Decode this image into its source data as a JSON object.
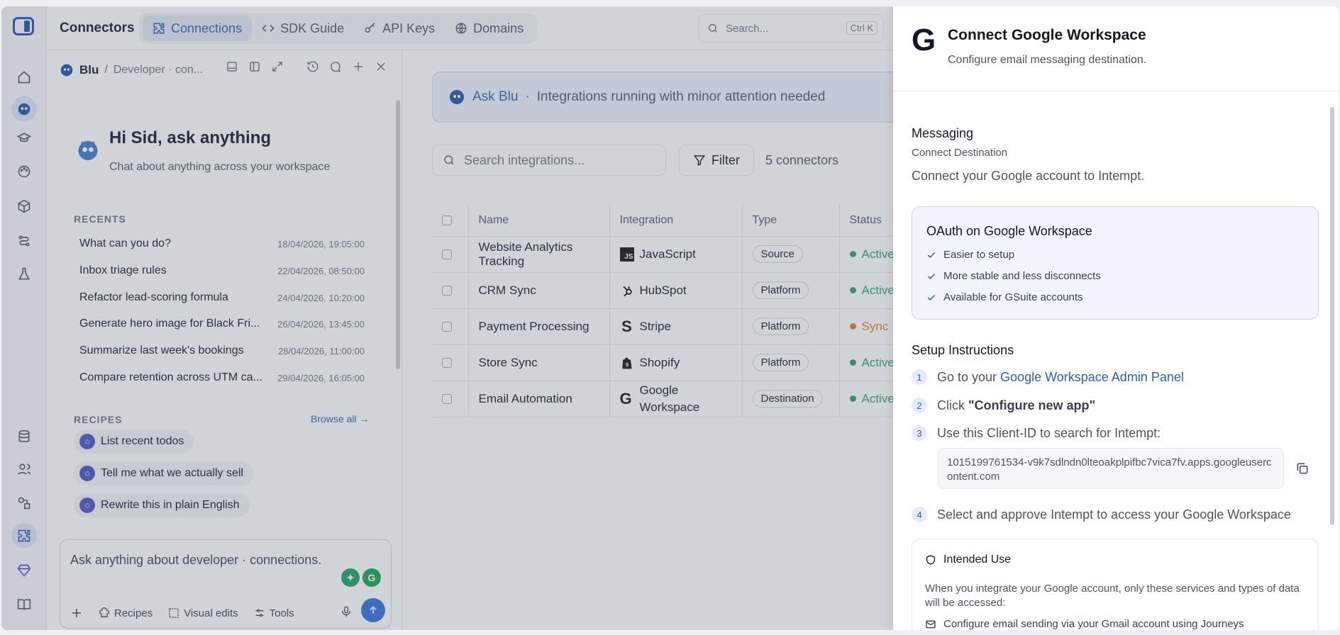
{
  "app": {
    "title": "Connectors"
  },
  "tabs": [
    {
      "label": "Connections"
    },
    {
      "label": "SDK Guide"
    },
    {
      "label": "API Keys"
    },
    {
      "label": "Domains"
    }
  ],
  "search": {
    "placeholder": "Search...",
    "shortcut": "Ctrl K"
  },
  "chat": {
    "agent_name": "Blu",
    "crumb": "Developer · con...",
    "greeting": "Hi Sid, ask anything",
    "subtitle": "Chat about anything across your workspace",
    "recents_label": "RECENTS",
    "recents": [
      {
        "title": "What can you do?",
        "date": "18/04/2026, 19:05:00"
      },
      {
        "title": "Inbox triage rules",
        "date": "22/04/2026, 08:50:00"
      },
      {
        "title": "Refactor lead-scoring formula",
        "date": "24/04/2026, 10:20:00"
      },
      {
        "title": "Generate hero image for Black Fri...",
        "date": "26/04/2026, 13:45:00"
      },
      {
        "title": "Summarize last week's bookings",
        "date": "28/04/2026, 11:00:00"
      },
      {
        "title": "Compare retention across UTM ca...",
        "date": "29/04/2026, 16:05:00"
      }
    ],
    "recipes_label": "RECIPES",
    "browse_all": "Browse all →",
    "recipes": [
      "List recent todos",
      "Tell me what we actually sell",
      "Rewrite this in plain English"
    ],
    "input_placeholder": "Ask anything about developer · connections.",
    "tools": {
      "recipes": "Recipes",
      "visual_edits": "Visual edits",
      "tools": "Tools"
    }
  },
  "main": {
    "ask_label": "Ask Blu",
    "ask_status": "Integrations running with minor attention needed",
    "search_placeholder": "Search integrations...",
    "filter_label": "Filter",
    "count": "5 connectors",
    "columns": [
      "Name",
      "Integration",
      "Type",
      "Status"
    ],
    "rows": [
      {
        "name": "Website Analytics Tracking",
        "integration": "JavaScript",
        "type": "Source",
        "status": "Active",
        "status_color": "#2f9e5a",
        "icon": "js-icon"
      },
      {
        "name": "CRM Sync",
        "integration": "HubSpot",
        "type": "Platform",
        "status": "Active",
        "status_color": "#2f9e5a",
        "icon": "hubspot-icon"
      },
      {
        "name": "Payment Processing",
        "integration": "Stripe",
        "type": "Platform",
        "status": "Sync",
        "status_color": "#d9822b",
        "icon": "stripe-icon"
      },
      {
        "name": "Store Sync",
        "integration": "Shopify",
        "type": "Platform",
        "status": "Active",
        "status_color": "#2f9e5a",
        "icon": "shopify-icon"
      },
      {
        "name": "Email Automation",
        "integration": "Google Workspace",
        "type": "Destination",
        "status": "Active",
        "status_color": "#2f9e5a",
        "icon": "google-icon"
      }
    ]
  },
  "drawer": {
    "title": "Connect Google Workspace",
    "subtitle": "Configure email messaging destination.",
    "section": "Messaging",
    "section_sub": "Connect Destination",
    "intro": "Connect your Google account to Intempt.",
    "oauth_title": "OAuth on Google Workspace",
    "oauth_points": [
      "Easier to setup",
      "More stable and less disconnects",
      "Available for GSuite accounts"
    ],
    "setup_title": "Setup Instructions",
    "step1_prefix": "Go to your ",
    "step1_link": "Google Workspace Admin Panel",
    "step2_prefix": "Click ",
    "step2_bold": "\"Configure new app\"",
    "step3": "Use this Client-ID to search for Intempt:",
    "client_id": "1015199761534-v9k7sdlndn0lteoakplpifbc7vica7fv.apps.googleusercontent.com",
    "step4": "Select and approve Intempt to access your Google Workspace",
    "intended_title": "Intended Use",
    "intended_text": "When you integrate your Google account, only these services and types of data will be accessed:",
    "intended_item": "Configure email sending via your Gmail account using Journeys"
  },
  "colors": {
    "accent": "#2f5fb0",
    "send": "#2f6fd6"
  }
}
